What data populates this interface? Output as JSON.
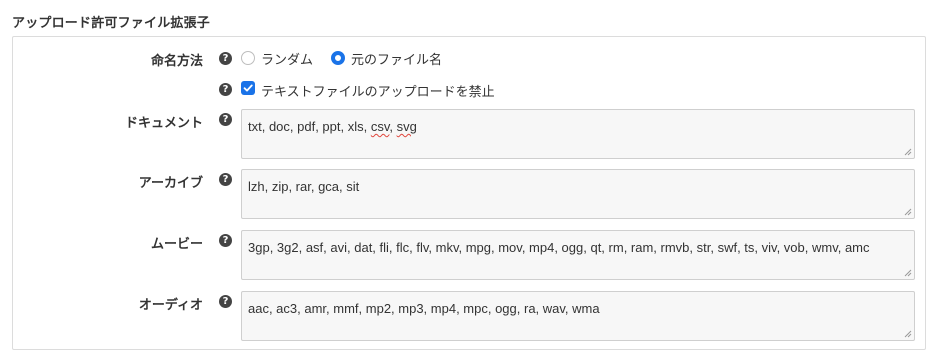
{
  "section_title": "アップロード許可ファイル拡張子",
  "naming": {
    "label": "命名方法",
    "options": [
      {
        "label": "ランダム",
        "checked": false
      },
      {
        "label": "元のファイル名",
        "checked": true
      }
    ]
  },
  "text_upload_ban": {
    "label": "テキストファイルのアップロードを禁止",
    "checked": true
  },
  "help_glyph": "?",
  "fields": {
    "document": {
      "label": "ドキュメント",
      "value_plain": "txt, doc, pdf, ppt, xls, ",
      "value_flag1": "csv",
      "value_sep": ", ",
      "value_flag2": "svg"
    },
    "archive": {
      "label": "アーカイブ",
      "value": "lzh, zip, rar, gca, sit"
    },
    "movie": {
      "label": "ムービー",
      "value": "3gp, 3g2, asf, avi, dat, fli, flc, flv, mkv, mpg, mov, mp4, ogg, qt, rm, ram, rmvb, str, swf, ts, viv, vob, wmv, amc"
    },
    "audio": {
      "label": "オーディオ",
      "value": "aac, ac3, amr, mmf, mp2, mp3, mp4, mpc, ogg, ra, wav, wma"
    }
  },
  "colors": {
    "accent": "#1a73e8",
    "help": "#444444",
    "field_bg": "#f7f7f7",
    "border": "#dcdcdc"
  }
}
